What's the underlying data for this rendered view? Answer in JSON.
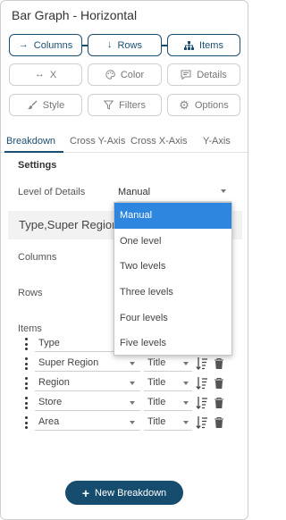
{
  "panel": {
    "title": "Bar Graph - Horizontal"
  },
  "buttons": {
    "columns": {
      "label": "Columns",
      "icon": "arrow-right-icon"
    },
    "rows": {
      "label": "Rows",
      "icon": "arrow-down-icon"
    },
    "items": {
      "label": "Items",
      "icon": "hierarchy-icon"
    },
    "x": {
      "label": "X",
      "icon": "double-arrow-icon"
    },
    "color": {
      "label": "Color",
      "icon": "palette-icon"
    },
    "details": {
      "label": "Details",
      "icon": "comment-icon"
    },
    "style": {
      "label": "Style",
      "icon": "brush-icon"
    },
    "filters": {
      "label": "Filters",
      "icon": "funnel-icon"
    },
    "options": {
      "label": "Options",
      "icon": "gear-icon"
    }
  },
  "tabs": [
    "Breakdown",
    "Cross Y-Axis",
    "Cross X-Axis",
    "Y-Axis"
  ],
  "settings": {
    "heading": "Settings",
    "level_of_details_label": "Level of Details",
    "level_of_details_value": "Manual"
  },
  "group_title": "Type,Super Region,",
  "labels": {
    "columns": "Columns",
    "rows": "Rows",
    "items": "Items"
  },
  "dropdown_options": [
    "Manual",
    "One level",
    "Two levels",
    "Three levels",
    "Four levels",
    "Five levels"
  ],
  "items": [
    {
      "field": "Type",
      "agg": ""
    },
    {
      "field": "Super Region",
      "agg": "Title"
    },
    {
      "field": "Region",
      "agg": "Title"
    },
    {
      "field": "Store",
      "agg": "Title"
    },
    {
      "field": "Area",
      "agg": "Title"
    }
  ],
  "new_breakdown_label": "New Breakdown",
  "colors": {
    "accent": "#1b4f72",
    "primary_button": "#164c6d",
    "selected_option": "#2e86de"
  }
}
